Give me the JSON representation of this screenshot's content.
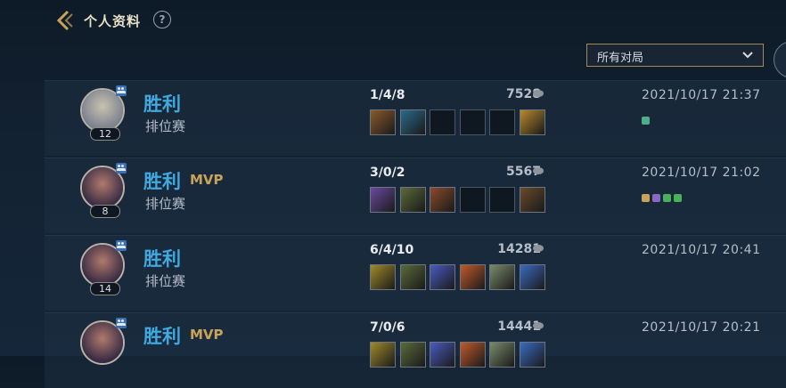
{
  "header": {
    "title": "个人资料",
    "help_label": "?"
  },
  "filter": {
    "selected": "所有对局"
  },
  "matches": [
    {
      "result": "胜利",
      "mvp": "",
      "mode": "排位赛",
      "level": "12",
      "kda": "1/4/8",
      "gold": "7528",
      "date": "2021/10/17 21:37",
      "portrait_colors": [
        "#7c8190",
        "#c8c2b0"
      ],
      "items": [
        "#8a5a2a",
        "#2b6a8c",
        "",
        "",
        "",
        "#b58a2a"
      ],
      "badges": [
        "#4bb08a"
      ]
    },
    {
      "result": "胜利",
      "mvp": "MVP",
      "mode": "排位赛",
      "level": "8",
      "kda": "3/0/2",
      "gold": "5567",
      "date": "2021/10/17 21:02",
      "portrait_colors": [
        "#3a2c44",
        "#b07a6c"
      ],
      "items": [
        "#6a4aa0",
        "#5a6a3a",
        "#8a4a2a",
        "",
        "",
        "#6a4a2a"
      ],
      "badges": [
        "#c9a35a",
        "#8a6ac0",
        "#4bb05a",
        "#4bb05a"
      ]
    },
    {
      "result": "胜利",
      "mvp": "",
      "mode": "排位赛",
      "level": "14",
      "kda": "6/4/10",
      "gold": "14281",
      "date": "2021/10/17 20:41",
      "portrait_colors": [
        "#3a2c44",
        "#b07a6c"
      ],
      "items": [
        "#a08a2a",
        "#5a6a3a",
        "#4a5ac0",
        "#c05a2a",
        "#7a8a6a",
        "#3a6ac0"
      ],
      "badges": []
    },
    {
      "result": "胜利",
      "mvp": "MVP",
      "mode": "",
      "level": "",
      "kda": "7/0/6",
      "gold": "14441",
      "date": "2021/10/17 20:21",
      "portrait_colors": [
        "#3a2c44",
        "#b07a6c"
      ],
      "items": [
        "#a08a2a",
        "#5a6a3a",
        "#4a5ac0",
        "#c05a2a",
        "#7a8a6a",
        "#3a6ac0"
      ],
      "badges": []
    }
  ]
}
